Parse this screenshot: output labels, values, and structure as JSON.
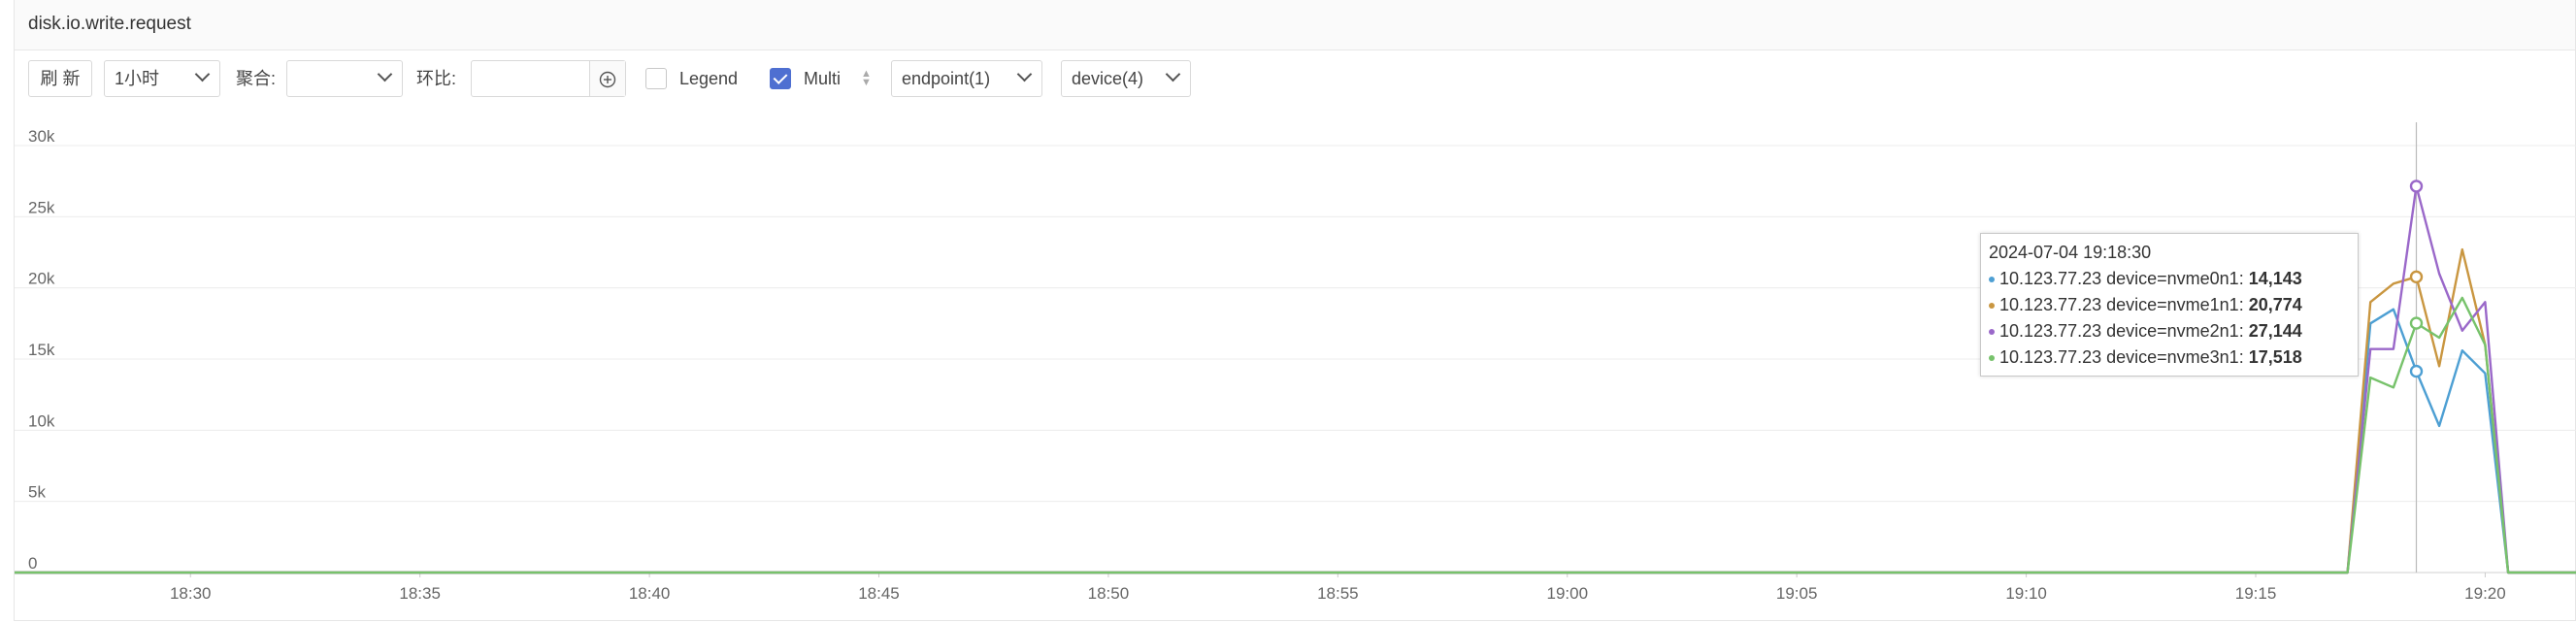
{
  "panel": {
    "title": "disk.io.write.request"
  },
  "toolbar": {
    "refresh_label": "刷 新",
    "time_range": "1小时",
    "aggregate_label": "聚合:",
    "aggregate_value": "",
    "compare_label": "环比:",
    "compare_value": "",
    "add_icon": "plus-circle-icon",
    "legend_label": "Legend",
    "legend_checked": false,
    "multi_label": "Multi",
    "multi_checked": true,
    "endpoint_select": "endpoint(1)",
    "device_select": "device(4)"
  },
  "tooltip": {
    "time": "2024-07-04 19:18:30",
    "rows": [
      {
        "name": "10.123.77.23 device=nvme0n1:",
        "value": "14,143"
      },
      {
        "name": "10.123.77.23 device=nvme1n1:",
        "value": "20,774"
      },
      {
        "name": "10.123.77.23 device=nvme2n1:",
        "value": "27,144"
      },
      {
        "name": "10.123.77.23 device=nvme3n1:",
        "value": "17,518"
      }
    ]
  },
  "chart_data": {
    "type": "line",
    "title": "",
    "xlabel": "",
    "ylabel": "",
    "ylim": [
      0,
      30000
    ],
    "xlim": [
      "18:26:10",
      "19:22:00"
    ],
    "yticks": [
      "0",
      "5k",
      "10k",
      "15k",
      "20k",
      "25k",
      "30k"
    ],
    "ytick_values": [
      0,
      5000,
      10000,
      15000,
      20000,
      25000,
      30000
    ],
    "xticks": [
      "18:30",
      "18:35",
      "18:40",
      "18:45",
      "18:50",
      "18:55",
      "19:00",
      "19:05",
      "19:10",
      "19:15",
      "19:20"
    ],
    "grid": true,
    "legend": "none",
    "crosshair_x": "19:18:30",
    "series": [
      {
        "name": "10.123.77.23 device=nvme0n1",
        "color": "#4d9fd3",
        "points": [
          [
            "18:26:10",
            0
          ],
          [
            "19:17:00",
            0
          ],
          [
            "19:17:30",
            17500
          ],
          [
            "19:18:00",
            18500
          ],
          [
            "19:18:30",
            14143
          ],
          [
            "19:19:00",
            10300
          ],
          [
            "19:19:30",
            15600
          ],
          [
            "19:20:00",
            14000
          ],
          [
            "19:20:30",
            0
          ],
          [
            "19:22:00",
            0
          ]
        ]
      },
      {
        "name": "10.123.77.23 device=nvme1n1",
        "color": "#c99640",
        "points": [
          [
            "18:26:10",
            0
          ],
          [
            "19:17:00",
            0
          ],
          [
            "19:17:30",
            19000
          ],
          [
            "19:18:00",
            20300
          ],
          [
            "19:18:30",
            20774
          ],
          [
            "19:19:00",
            14500
          ],
          [
            "19:19:30",
            22700
          ],
          [
            "19:20:00",
            16000
          ],
          [
            "19:20:30",
            0
          ],
          [
            "19:22:00",
            0
          ]
        ]
      },
      {
        "name": "10.123.77.23 device=nvme2n1",
        "color": "#9a68c9",
        "points": [
          [
            "18:26:10",
            0
          ],
          [
            "19:17:00",
            0
          ],
          [
            "19:17:30",
            15700
          ],
          [
            "19:18:00",
            15700
          ],
          [
            "19:18:30",
            27144
          ],
          [
            "19:19:00",
            21000
          ],
          [
            "19:19:30",
            17000
          ],
          [
            "19:20:00",
            19000
          ],
          [
            "19:20:30",
            0
          ],
          [
            "19:22:00",
            0
          ]
        ]
      },
      {
        "name": "10.123.77.23 device=nvme3n1",
        "color": "#77c26b",
        "points": [
          [
            "18:26:10",
            0
          ],
          [
            "19:17:00",
            0
          ],
          [
            "19:17:30",
            13700
          ],
          [
            "19:18:00",
            13000
          ],
          [
            "19:18:30",
            17518
          ],
          [
            "19:19:00",
            16500
          ],
          [
            "19:19:30",
            19300
          ],
          [
            "19:20:00",
            16000
          ],
          [
            "19:20:30",
            0
          ],
          [
            "19:22:00",
            0
          ]
        ]
      }
    ]
  }
}
